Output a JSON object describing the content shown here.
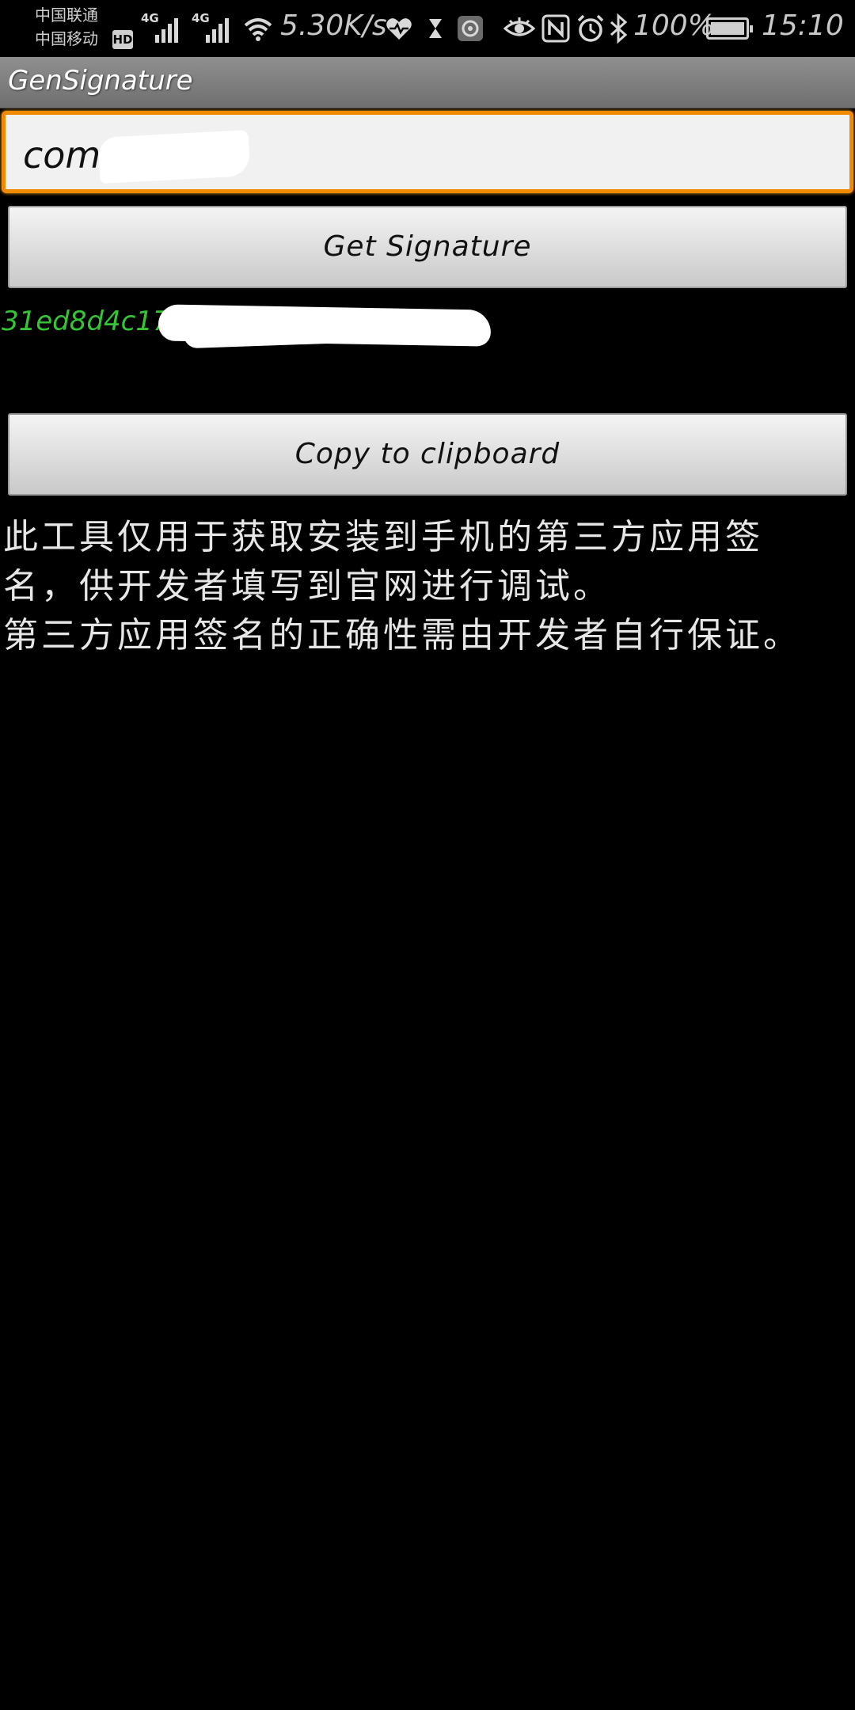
{
  "status_bar": {
    "carrier_1": "中国联通",
    "carrier_2": "中国移动",
    "hd_badge": "HD",
    "network_1": "4G",
    "network_2": "4G",
    "net_speed": "5.30K/s",
    "battery_percent": "100%",
    "time": "15:10",
    "icons": [
      "wifi-icon",
      "heart-rate-icon",
      "hourglass-icon",
      "app-notification-icon",
      "eye-icon",
      "nfc-icon",
      "alarm-icon",
      "bluetooth-icon",
      "battery-icon"
    ]
  },
  "app_bar": {
    "title": "GenSignature"
  },
  "package_input": {
    "value": "com."
  },
  "buttons": {
    "get_signature": "Get Signature",
    "copy_clipboard": "Copy to clipboard"
  },
  "signature": {
    "visible_prefix": "31ed8d4c1705"
  },
  "notice": {
    "line_1": "此工具仅用于获取安装到手机的第三方应用签",
    "line_2": "名，供开发者填写到官网进行调试。",
    "line_3": "第三方应用签名的正确性需由开发者自行保证。"
  },
  "colors": {
    "input_focus_border": "#f08a00",
    "signature_text": "#35c535",
    "background": "#000000",
    "title_bar": "#7f7f7f"
  }
}
